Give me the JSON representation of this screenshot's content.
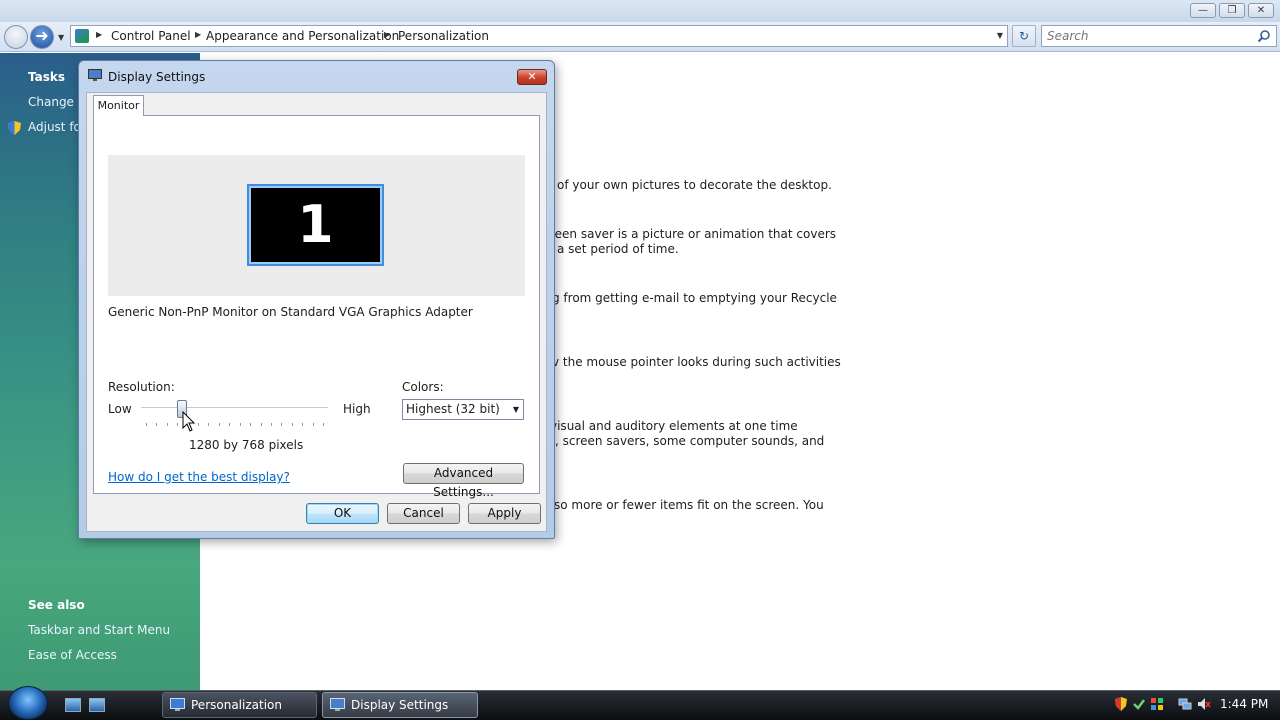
{
  "window": {
    "controls": {
      "minimize": "—",
      "maximize": "❐",
      "close": "✕"
    }
  },
  "address_bar": {
    "breadcrumbs": [
      "Control Panel",
      "Appearance and Personalization",
      "Personalization"
    ],
    "search_placeholder": "Search"
  },
  "left_pane": {
    "tasks_heading": "Tasks",
    "task_links": [
      "Change d",
      "Adjust fo"
    ],
    "see_also_heading": "See also",
    "see_also_links": [
      "Taskbar and Start Menu",
      "Ease of Access"
    ]
  },
  "content_fragments": [
    "of your own pictures to decorate the desktop.",
    "reen saver is a picture or animation that covers",
    "a set period of time.",
    "g from getting e-mail to emptying your Recycle",
    "v the mouse pointer looks during such activities",
    "visual and auditory elements at one time",
    ", screen savers, some computer sounds, and",
    "so more or fewer items fit on the screen. You"
  ],
  "dialog": {
    "title": "Display Settings",
    "tab_label": "Monitor",
    "monitor_number": "1",
    "monitor_description": "Generic Non-PnP Monitor on Standard VGA Graphics Adapter",
    "resolution_label": "Resolution:",
    "slider_low": "Low",
    "slider_high": "High",
    "resolution_value": "1280 by 768 pixels",
    "resolution_slider_position": 0.22,
    "colors_label": "Colors:",
    "colors_selected": "Highest (32 bit)",
    "help_link": "How do I get the best display?",
    "advanced_button": "Advanced Settings...",
    "ok_button": "OK",
    "cancel_button": "Cancel",
    "apply_button": "Apply"
  },
  "taskbar": {
    "tasks": [
      "Personalization",
      "Display Settings"
    ],
    "clock": "1:44 PM"
  }
}
